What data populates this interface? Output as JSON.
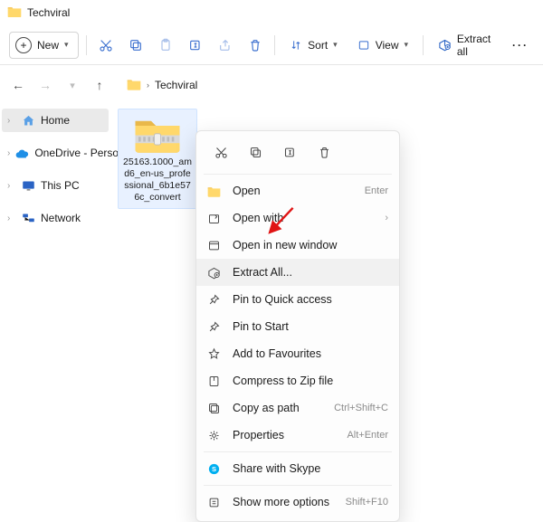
{
  "window": {
    "title": "Techviral"
  },
  "toolbar": {
    "new_label": "New",
    "sort_label": "Sort",
    "view_label": "View",
    "extract_label": "Extract all"
  },
  "breadcrumb": {
    "current": "Techviral"
  },
  "sidebar": {
    "items": [
      {
        "label": "Home"
      },
      {
        "label": "OneDrive - Personal"
      },
      {
        "label": "This PC"
      },
      {
        "label": "Network"
      }
    ]
  },
  "file": {
    "name": "25163.1000_amd6_en-us_professional_6b1e576c_convert"
  },
  "context_menu": {
    "items": [
      {
        "label": "Open",
        "hint": "Enter"
      },
      {
        "label": "Open with",
        "hint": ""
      },
      {
        "label": "Open in new window",
        "hint": ""
      },
      {
        "label": "Extract All...",
        "hint": ""
      },
      {
        "label": "Pin to Quick access",
        "hint": ""
      },
      {
        "label": "Pin to Start",
        "hint": ""
      },
      {
        "label": "Add to Favourites",
        "hint": ""
      },
      {
        "label": "Compress to Zip file",
        "hint": ""
      },
      {
        "label": "Copy as path",
        "hint": "Ctrl+Shift+C"
      },
      {
        "label": "Properties",
        "hint": "Alt+Enter"
      },
      {
        "label": "Share with Skype",
        "hint": ""
      },
      {
        "label": "Show more options",
        "hint": "Shift+F10"
      }
    ]
  }
}
